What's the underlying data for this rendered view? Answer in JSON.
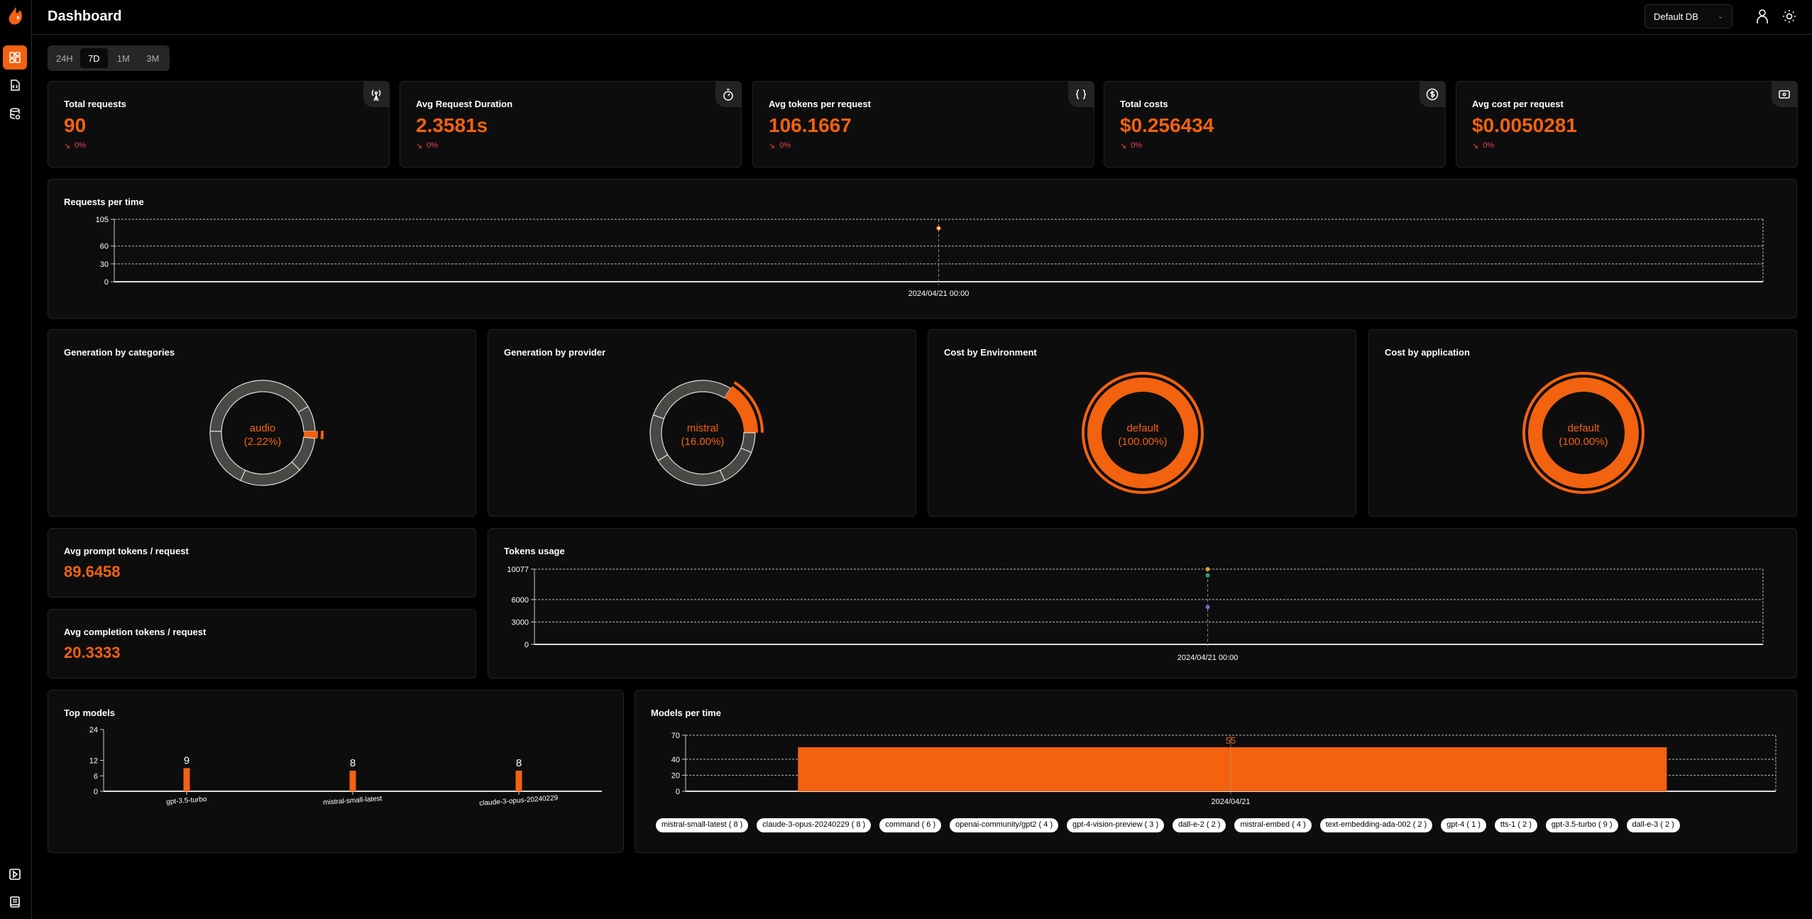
{
  "header": {
    "title": "Dashboard",
    "db_select": "Default DB"
  },
  "sidebar": {
    "items": [
      {
        "icon": "dashboard-icon",
        "active": true
      },
      {
        "icon": "file-code-icon"
      },
      {
        "icon": "database-icon"
      }
    ],
    "bottom": [
      {
        "icon": "play-icon"
      },
      {
        "icon": "book-icon"
      }
    ]
  },
  "range_tabs": [
    {
      "label": "24H"
    },
    {
      "label": "7D",
      "active": true
    },
    {
      "label": "1M"
    },
    {
      "label": "3M"
    }
  ],
  "colors": {
    "accent": "#f2620f",
    "negative": "#e5484d",
    "card": "#0e0d0e"
  },
  "stats": [
    {
      "title": "Total requests",
      "value": "90",
      "delta": "0%",
      "icon": "antenna-icon"
    },
    {
      "title": "Avg Request Duration",
      "value": "2.3581s",
      "delta": "0%",
      "icon": "stopwatch-icon"
    },
    {
      "title": "Avg tokens per request",
      "value": "106.1667",
      "delta": "0%",
      "icon": "braces-icon"
    },
    {
      "title": "Total costs",
      "value": "$0.256434",
      "delta": "0%",
      "icon": "dollar-circle-icon"
    },
    {
      "title": "Avg cost per request",
      "value": "$0.0050281",
      "delta": "0%",
      "icon": "banknote-icon"
    }
  ],
  "avg_prompt": {
    "title": "Avg prompt tokens / request",
    "value": "89.6458"
  },
  "avg_completion": {
    "title": "Avg completion tokens / request",
    "value": "20.3333"
  },
  "chart_data": [
    {
      "id": "requests",
      "type": "scatter",
      "title": "Requests per time",
      "x": [
        "2024/04/21 00:00"
      ],
      "values": [
        90
      ],
      "yticks": [
        "0",
        "30",
        "60",
        "105"
      ],
      "ylim": [
        0,
        105
      ],
      "grid": true,
      "color": "#f2620f"
    },
    {
      "id": "categories",
      "type": "pie",
      "title": "Generation by categories",
      "highlight": {
        "label": "audio",
        "percent": "(2.22%)"
      },
      "slices": [
        41,
        7.8,
        2.22,
        10.8,
        19.4,
        18.6
      ],
      "highlight_index": 2,
      "donut": true
    },
    {
      "id": "provider",
      "type": "pie",
      "title": "Generation by provider",
      "highlight": {
        "label": "mistral",
        "percent": "(16.00%)"
      },
      "slices": [
        28.3,
        16,
        6.1,
        12,
        23,
        14.4
      ],
      "highlight_index": 1,
      "donut": true
    },
    {
      "id": "environment",
      "type": "pie",
      "title": "Cost by Environment",
      "highlight": {
        "label": "default",
        "percent": "(100.00%)"
      },
      "slices": [
        100
      ],
      "highlight_index": 0,
      "donut": true
    },
    {
      "id": "application",
      "type": "pie",
      "title": "Cost by application",
      "highlight": {
        "label": "default",
        "percent": "(100.00%)"
      },
      "slices": [
        100
      ],
      "highlight_index": 0,
      "donut": true
    },
    {
      "id": "tokens",
      "type": "scatter",
      "title": "Tokens usage",
      "x": [
        "2024/04/21 00:00"
      ],
      "series": [
        {
          "values": [
            10077
          ],
          "color": "#e0a030"
        },
        {
          "values": [
            9250
          ],
          "color": "#3f9a6a"
        },
        {
          "values": [
            5000
          ],
          "color": "#6b6bc7"
        }
      ],
      "yticks": [
        "0",
        "3000",
        "6000",
        "10077"
      ],
      "ylim": [
        0,
        10077
      ],
      "grid": true
    },
    {
      "id": "top_models",
      "type": "bar",
      "title": "Top models",
      "categories": [
        "gpt-3.5-turbo",
        "mistral-small-latest",
        "claude-3-opus-20240229"
      ],
      "values": [
        9,
        8,
        8
      ],
      "yticks": [
        "0",
        "6",
        "12",
        "24"
      ],
      "ylim": [
        0,
        24
      ],
      "color": "#f2620f"
    },
    {
      "id": "models_time",
      "type": "bar",
      "title": "Models per time",
      "categories": [
        "2024/04/21"
      ],
      "values": [
        55
      ],
      "yticks": [
        "0",
        "20",
        "40",
        "70"
      ],
      "ylim": [
        0,
        70
      ],
      "grid": true,
      "color": "#f2620f",
      "legend": [
        "mistral-small-latest ( 8 )",
        "claude-3-opus-20240229 ( 8 )",
        "command ( 6 )",
        "openai-community/gpt2 ( 4 )",
        "gpt-4-vision-preview ( 3 )",
        "dall-e-2 ( 2 )",
        "mistral-embed ( 4 )",
        "text-embedding-ada-002 ( 2 )",
        "gpt-4 ( 1 )",
        "tts-1 ( 2 )",
        "gpt-3.5-turbo ( 9 )",
        "dall-e-3 ( 2 )"
      ],
      "legend_placement": "bottom"
    }
  ]
}
